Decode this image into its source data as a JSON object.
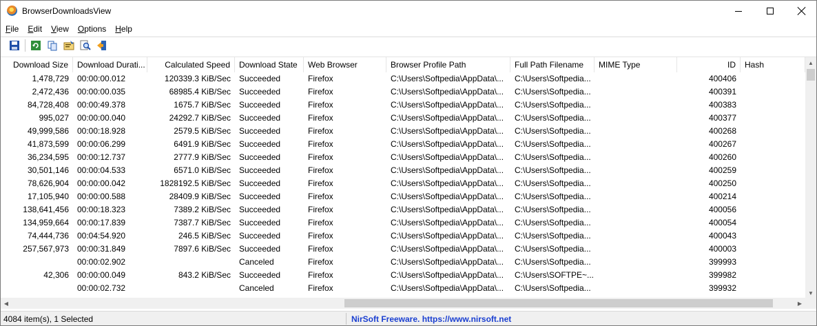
{
  "window": {
    "title": "BrowserDownloadsView"
  },
  "menu": [
    "File",
    "Edit",
    "View",
    "Options",
    "Help"
  ],
  "toolbar": {
    "buttons": [
      "save-icon",
      "refresh-icon",
      "copy-icon",
      "properties-icon",
      "find-icon",
      "exit-icon"
    ]
  },
  "columns": [
    {
      "label": "Download Size",
      "align": "right"
    },
    {
      "label": "Download Durati...",
      "align": "left"
    },
    {
      "label": "Calculated Speed",
      "align": "right"
    },
    {
      "label": "Download State",
      "align": "left"
    },
    {
      "label": "Web Browser",
      "align": "left"
    },
    {
      "label": "Browser Profile Path",
      "align": "left"
    },
    {
      "label": "Full Path Filename",
      "align": "left"
    },
    {
      "label": "MIME Type",
      "align": "left"
    },
    {
      "label": "ID",
      "align": "right"
    },
    {
      "label": "Hash",
      "align": "left"
    }
  ],
  "rows": [
    [
      "1,478,729",
      "00:00:00.012",
      "120339.3 KiB/Sec",
      "Succeeded",
      "Firefox",
      "C:\\Users\\Softpedia\\AppData\\...",
      "C:\\Users\\Softpedia...",
      "",
      "400406",
      ""
    ],
    [
      "2,472,436",
      "00:00:00.035",
      "68985.4 KiB/Sec",
      "Succeeded",
      "Firefox",
      "C:\\Users\\Softpedia\\AppData\\...",
      "C:\\Users\\Softpedia...",
      "",
      "400391",
      ""
    ],
    [
      "84,728,408",
      "00:00:49.378",
      "1675.7 KiB/Sec",
      "Succeeded",
      "Firefox",
      "C:\\Users\\Softpedia\\AppData\\...",
      "C:\\Users\\Softpedia...",
      "",
      "400383",
      ""
    ],
    [
      "995,027",
      "00:00:00.040",
      "24292.7 KiB/Sec",
      "Succeeded",
      "Firefox",
      "C:\\Users\\Softpedia\\AppData\\...",
      "C:\\Users\\Softpedia...",
      "",
      "400377",
      ""
    ],
    [
      "49,999,586",
      "00:00:18.928",
      "2579.5 KiB/Sec",
      "Succeeded",
      "Firefox",
      "C:\\Users\\Softpedia\\AppData\\...",
      "C:\\Users\\Softpedia...",
      "",
      "400268",
      ""
    ],
    [
      "41,873,599",
      "00:00:06.299",
      "6491.9 KiB/Sec",
      "Succeeded",
      "Firefox",
      "C:\\Users\\Softpedia\\AppData\\...",
      "C:\\Users\\Softpedia...",
      "",
      "400267",
      ""
    ],
    [
      "36,234,595",
      "00:00:12.737",
      "2777.9 KiB/Sec",
      "Succeeded",
      "Firefox",
      "C:\\Users\\Softpedia\\AppData\\...",
      "C:\\Users\\Softpedia...",
      "",
      "400260",
      ""
    ],
    [
      "30,501,146",
      "00:00:04.533",
      "6571.0 KiB/Sec",
      "Succeeded",
      "Firefox",
      "C:\\Users\\Softpedia\\AppData\\...",
      "C:\\Users\\Softpedia...",
      "",
      "400259",
      ""
    ],
    [
      "78,626,904",
      "00:00:00.042",
      "1828192.5 KiB/Sec",
      "Succeeded",
      "Firefox",
      "C:\\Users\\Softpedia\\AppData\\...",
      "C:\\Users\\Softpedia...",
      "",
      "400250",
      ""
    ],
    [
      "17,105,940",
      "00:00:00.588",
      "28409.9 KiB/Sec",
      "Succeeded",
      "Firefox",
      "C:\\Users\\Softpedia\\AppData\\...",
      "C:\\Users\\Softpedia...",
      "",
      "400214",
      ""
    ],
    [
      "138,641,456",
      "00:00:18.323",
      "7389.2 KiB/Sec",
      "Succeeded",
      "Firefox",
      "C:\\Users\\Softpedia\\AppData\\...",
      "C:\\Users\\Softpedia...",
      "",
      "400056",
      ""
    ],
    [
      "134,959,664",
      "00:00:17.839",
      "7387.7 KiB/Sec",
      "Succeeded",
      "Firefox",
      "C:\\Users\\Softpedia\\AppData\\...",
      "C:\\Users\\Softpedia...",
      "",
      "400054",
      ""
    ],
    [
      "74,444,736",
      "00:04:54.920",
      "246.5 KiB/Sec",
      "Succeeded",
      "Firefox",
      "C:\\Users\\Softpedia\\AppData\\...",
      "C:\\Users\\Softpedia...",
      "",
      "400043",
      ""
    ],
    [
      "257,567,973",
      "00:00:31.849",
      "7897.6 KiB/Sec",
      "Succeeded",
      "Firefox",
      "C:\\Users\\Softpedia\\AppData\\...",
      "C:\\Users\\Softpedia...",
      "",
      "400003",
      ""
    ],
    [
      "",
      "00:00:02.902",
      "",
      "Canceled",
      "Firefox",
      "C:\\Users\\Softpedia\\AppData\\...",
      "C:\\Users\\Softpedia...",
      "",
      "399993",
      ""
    ],
    [
      "42,306",
      "00:00:00.049",
      "843.2 KiB/Sec",
      "Succeeded",
      "Firefox",
      "C:\\Users\\Softpedia\\AppData\\...",
      "C:\\Users\\SOFTPE~...",
      "",
      "399982",
      ""
    ],
    [
      "",
      "00:00:02.732",
      "",
      "Canceled",
      "Firefox",
      "C:\\Users\\Softpedia\\AppData\\...",
      "C:\\Users\\Softpedia...",
      "",
      "399932",
      ""
    ]
  ],
  "status": {
    "items_text": "4084 item(s), 1 Selected",
    "link_text": "NirSoft Freeware. https://www.nirsoft.net"
  },
  "colors": {
    "link": "#1a3fd1",
    "statusbar_bg": "#f0f0f0",
    "scrollbar_thumb": "#cdcdcd"
  }
}
